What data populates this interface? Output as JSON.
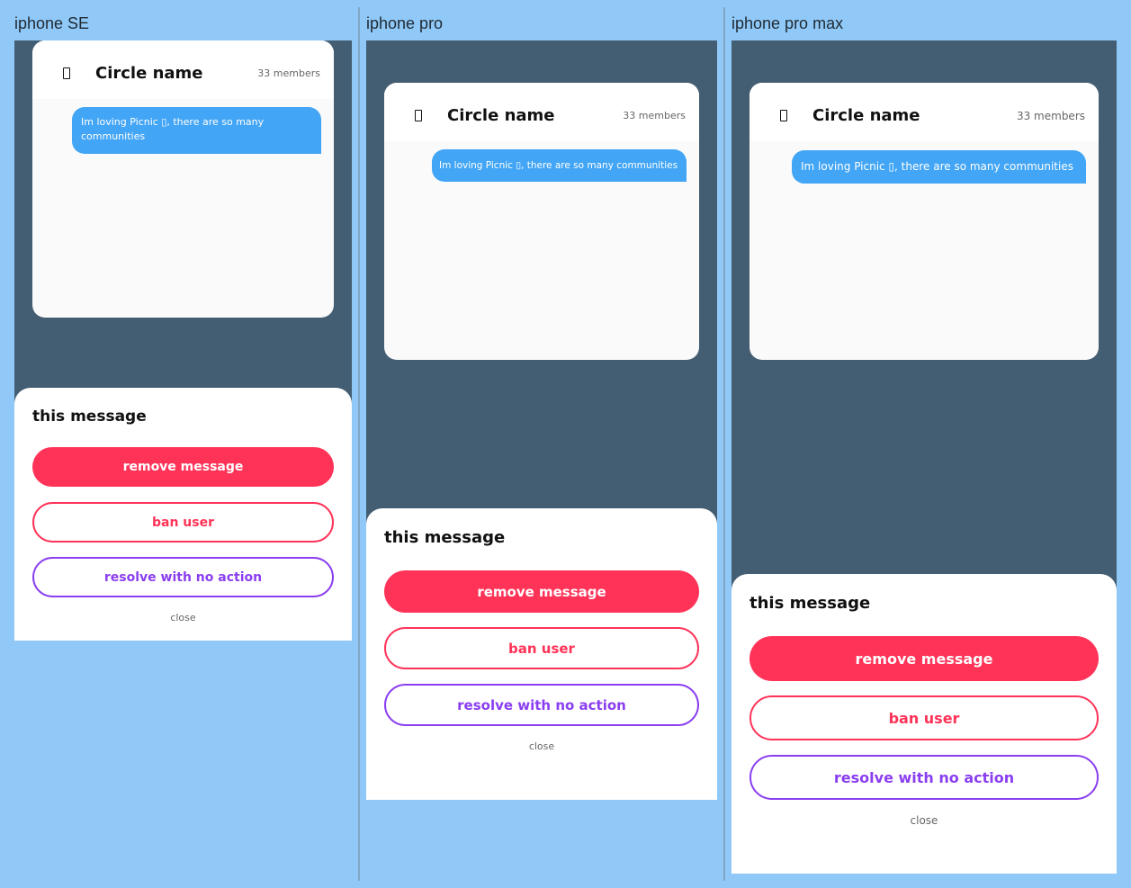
{
  "devices": [
    {
      "label": "iphone SE",
      "chat": {
        "circle_name": "Circle name",
        "members": "33 members",
        "message": "Im loving Picnic ▯, there are so many communities"
      },
      "sheet": {
        "title": "this message",
        "remove_label": "remove message",
        "ban_label": "ban user",
        "resolve_label": "resolve with no action",
        "close_label": "close"
      }
    },
    {
      "label": "iphone pro",
      "chat": {
        "circle_name": "Circle name",
        "members": "33 members",
        "message": "Im loving Picnic ▯, there are so many communities"
      },
      "sheet": {
        "title": "this message",
        "remove_label": "remove message",
        "ban_label": "ban user",
        "resolve_label": "resolve with no action",
        "close_label": "close"
      }
    },
    {
      "label": "iphone pro max",
      "chat": {
        "circle_name": "Circle name",
        "members": "33 members",
        "message": "Im loving Picnic ▯, there are so many communities"
      },
      "sheet": {
        "title": "this message",
        "remove_label": "remove message",
        "ban_label": "ban user",
        "resolve_label": "resolve with no action",
        "close_label": "close"
      }
    }
  ],
  "colors": {
    "page_background": "#90c9f7",
    "screen_overlay": "#435d73",
    "bubble": "#42a5f5",
    "remove": "#ff3358",
    "resolve": "#8a3ef0"
  }
}
